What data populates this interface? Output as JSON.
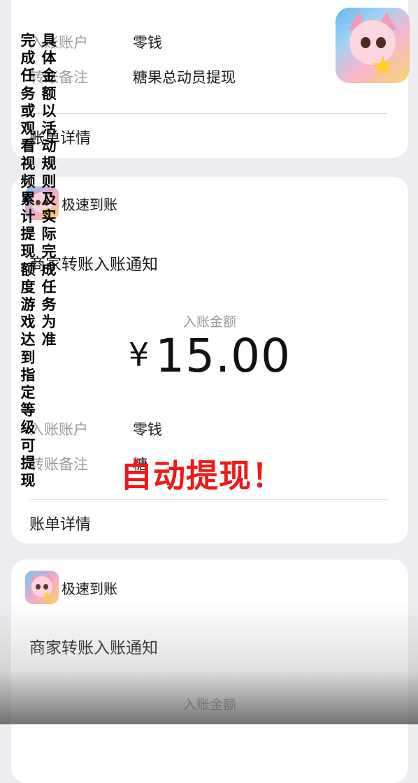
{
  "card1": {
    "account_label": "入账账户",
    "account_value": "零钱",
    "remark_label": "转账备注",
    "remark_value": "糖果总动员提现",
    "detail_label": "账单详情"
  },
  "card2": {
    "header_title": "极速到账",
    "notice_title": "商家转账入账通知",
    "amount_label": "入账金额",
    "currency": "¥",
    "amount": "15.00",
    "account_label": "入账账户",
    "account_value": "零钱",
    "remark_label": "转账备注",
    "remark_value": "糖",
    "detail_label": "账单详情"
  },
  "card3": {
    "header_title": "极速到账",
    "notice_title": "商家转账入账通知",
    "amount_label": "入账金额"
  },
  "overlay": {
    "promo_col1": "完成任务或观看视频累计提现额度 游戏达到指定等级可提现",
    "promo_col2": "具体金额以活动规则及实际完成任务为准",
    "red_text": "自动提现！"
  },
  "colors": {
    "background": "#ededf1",
    "card": "#ffffff",
    "label_gray": "#9b9b9b",
    "overlay_red": "#f01818"
  },
  "icons": {
    "app_icon": "cartoon-pink-cat-icon",
    "header_icon": "cartoon-pink-cat-icon"
  }
}
